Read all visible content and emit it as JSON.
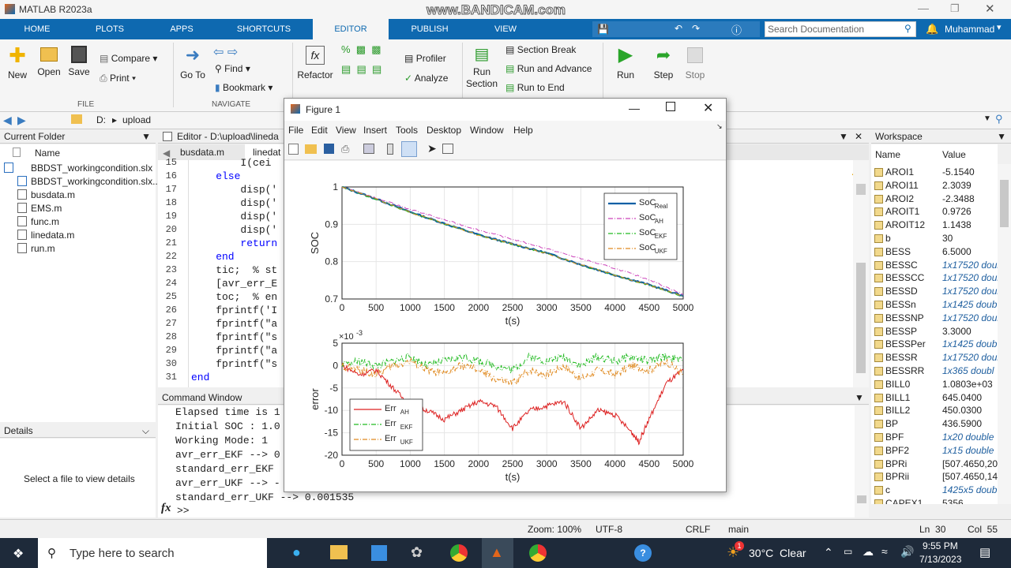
{
  "window": {
    "title": "MATLAB R2023a",
    "watermark": "www.BANDICAM.com"
  },
  "tabs": [
    "HOME",
    "PLOTS",
    "APPS",
    "SHORTCUTS",
    "EDITOR",
    "PUBLISH",
    "VIEW"
  ],
  "active_tab": "EDITOR",
  "search": {
    "placeholder": "Search Documentation"
  },
  "user": "Muhammad",
  "ribbon": {
    "file": {
      "new": "New",
      "open": "Open",
      "save": "Save",
      "compare": "Compare",
      "print": "Print",
      "section": "FILE"
    },
    "navigate": {
      "goto": "Go To",
      "find": "Find",
      "bookmark": "Bookmark",
      "section": "NAVIGATE"
    },
    "code": {
      "refactor": "Refactor",
      "profiler": "Profiler",
      "analyze": "Analyze"
    },
    "section": {
      "run_section": "Run Section",
      "section_break": "Section Break",
      "run_advance": "Run and Advance",
      "run_end": "Run to End"
    },
    "run": {
      "run": "Run",
      "step": "Step",
      "stop": "Stop"
    }
  },
  "address": {
    "drive": "D:",
    "folder": "upload"
  },
  "current_folder": {
    "title": "Current Folder",
    "col_name": "Name",
    "files": [
      "BBDST_workingcondition.slx",
      "BBDST_workingcondition.slx...",
      "busdata.m",
      "EMS.m",
      "func.m",
      "linedata.m",
      "run.m"
    ]
  },
  "details": {
    "title": "Details",
    "message": "Select a file to view details"
  },
  "editor": {
    "title": "Editor - D:\\upload\\lineda",
    "tabs": [
      "busdata.m",
      "linedat"
    ],
    "lines": [
      {
        "n": "15",
        "text": "        I(cei"
      },
      {
        "n": "16",
        "text": "    else"
      },
      {
        "n": "17",
        "text": "        disp('"
      },
      {
        "n": "18",
        "text": "        disp('"
      },
      {
        "n": "19",
        "text": "        disp('"
      },
      {
        "n": "20",
        "text": "        disp('"
      },
      {
        "n": "21",
        "text": "        return"
      },
      {
        "n": "22",
        "text": "    end"
      },
      {
        "n": "23",
        "text": "    tic;  % st"
      },
      {
        "n": "24",
        "text": "    [avr_err_E"
      },
      {
        "n": "25",
        "text": "    toc;  % en"
      },
      {
        "n": "26",
        "text": "    fprintf('I"
      },
      {
        "n": "27",
        "text": "    fprintf(\"a"
      },
      {
        "n": "28",
        "text": "    fprintf(\"s"
      },
      {
        "n": "29",
        "text": "    fprintf(\"a"
      },
      {
        "n": "30",
        "text": "    fprintf(\"s"
      },
      {
        "n": "31",
        "text": "end"
      }
    ]
  },
  "command_window": {
    "title": "Command Window",
    "lines": [
      "Elapsed time is 1",
      "Initial SOC : 1.0",
      "Working Mode: 1",
      "avr_err_EKF --> 0",
      "standard_err_EKF",
      "avr_err_UKF --> -",
      "standard_err_UKF --> 0.001535"
    ],
    "prompt": ">>",
    "fx": "fx"
  },
  "workspace": {
    "title": "Workspace",
    "col_name": "Name",
    "col_value": "Value",
    "vars": [
      {
        "name": "AROI1",
        "value": "-5.1540",
        "italic": false
      },
      {
        "name": "AROI11",
        "value": "2.3039",
        "italic": false
      },
      {
        "name": "AROI2",
        "value": "-2.3488",
        "italic": false
      },
      {
        "name": "AROIT1",
        "value": "0.9726",
        "italic": false
      },
      {
        "name": "AROIT12",
        "value": "1.1438",
        "italic": false
      },
      {
        "name": "b",
        "value": "30",
        "italic": false
      },
      {
        "name": "BESS",
        "value": "6.5000",
        "italic": false
      },
      {
        "name": "BESSC",
        "value": "1x17520 doub",
        "italic": true
      },
      {
        "name": "BESSCC",
        "value": "1x17520 doub",
        "italic": true
      },
      {
        "name": "BESSD",
        "value": "1x17520 doub",
        "italic": true
      },
      {
        "name": "BESSn",
        "value": "1x1425 doub",
        "italic": true
      },
      {
        "name": "BESSNP",
        "value": "1x17520 doub",
        "italic": true
      },
      {
        "name": "BESSP",
        "value": "3.3000",
        "italic": false
      },
      {
        "name": "BESSPer",
        "value": "1x1425 doub",
        "italic": true
      },
      {
        "name": "BESSR",
        "value": "1x17520 doub",
        "italic": true
      },
      {
        "name": "BESSRR",
        "value": "1x365 doubl",
        "italic": true
      },
      {
        "name": "BILL0",
        "value": "1.0803e+03",
        "italic": false
      },
      {
        "name": "BILL1",
        "value": "645.0400",
        "italic": false
      },
      {
        "name": "BILL2",
        "value": "450.0300",
        "italic": false
      },
      {
        "name": "BP",
        "value": "436.5900",
        "italic": false
      },
      {
        "name": "BPF",
        "value": "1x20 double",
        "italic": true
      },
      {
        "name": "BPF2",
        "value": "1x15 double",
        "italic": true
      },
      {
        "name": "BPRi",
        "value": "[507.4650,20",
        "italic": false
      },
      {
        "name": "BPRii",
        "value": "[507.4650,14",
        "italic": false
      },
      {
        "name": "c",
        "value": "1425x5 doub",
        "italic": true
      },
      {
        "name": "CAPEX1",
        "value": "5356",
        "italic": false
      }
    ]
  },
  "status": {
    "zoom": "Zoom: 100%",
    "encoding": "UTF-8",
    "eol": "CRLF",
    "func": "main",
    "ln": "Ln  30",
    "col": "Col  55"
  },
  "taskbar": {
    "search": "Type here to search",
    "weather": "30°C  Clear",
    "time": "9:55 PM",
    "date": "7/13/2023",
    "badge": "1"
  },
  "figure": {
    "title": "Figure 1",
    "menu": [
      "File",
      "Edit",
      "View",
      "Insert",
      "Tools",
      "Desktop",
      "Window",
      "Help"
    ]
  },
  "chart_data": [
    {
      "type": "line",
      "xlabel": "t(s)",
      "ylabel": "SOC",
      "xlim": [
        0,
        5000
      ],
      "ylim": [
        0.7,
        1.0
      ],
      "xticks": [
        "0",
        "500",
        "1000",
        "1500",
        "2000",
        "2500",
        "3000",
        "3500",
        "4000",
        "4500",
        "5000"
      ],
      "yticks": [
        "0.7",
        "0.8",
        "0.9",
        "1"
      ],
      "legend_position": "top-right",
      "series": [
        {
          "name": "SoC",
          "sub": "Real",
          "color": "#0b5fa5",
          "style": "solid",
          "x": [
            0,
            500,
            1000,
            1500,
            2000,
            2500,
            3000,
            3500,
            4000,
            4500,
            5000
          ],
          "values": [
            1.0,
            0.968,
            0.933,
            0.902,
            0.872,
            0.847,
            0.823,
            0.792,
            0.764,
            0.738,
            0.708
          ]
        },
        {
          "name": "SoC",
          "sub": "AH",
          "color": "#cc44bb",
          "style": "dashdot",
          "x": [
            0,
            500,
            1000,
            1500,
            2000,
            2500,
            3000,
            3500,
            4000,
            4500,
            5000
          ],
          "values": [
            1.0,
            0.97,
            0.94,
            0.912,
            0.885,
            0.86,
            0.835,
            0.808,
            0.782,
            0.752,
            0.712
          ]
        },
        {
          "name": "SoC",
          "sub": "EKF",
          "color": "#22bb22",
          "style": "dashdot",
          "x": [
            0,
            500,
            1000,
            1500,
            2000,
            2500,
            3000,
            3500,
            4000,
            4500,
            5000
          ],
          "values": [
            1.0,
            0.967,
            0.932,
            0.901,
            0.871,
            0.846,
            0.822,
            0.791,
            0.763,
            0.737,
            0.707
          ]
        },
        {
          "name": "SoC",
          "sub": "UKF",
          "color": "#e08a20",
          "style": "dashdot",
          "x": [
            0,
            500,
            1000,
            1500,
            2000,
            2500,
            3000,
            3500,
            4000,
            4500,
            5000
          ],
          "values": [
            1.0,
            0.968,
            0.932,
            0.902,
            0.871,
            0.847,
            0.822,
            0.792,
            0.764,
            0.737,
            0.708
          ]
        }
      ]
    },
    {
      "type": "line",
      "xlabel": "t(s)",
      "ylabel": "error",
      "scale_label": "×10",
      "scale_exp": "-3",
      "xlim": [
        0,
        5000
      ],
      "ylim": [
        -20,
        5
      ],
      "xticks": [
        "0",
        "500",
        "1000",
        "1500",
        "2000",
        "2500",
        "3000",
        "3500",
        "4000",
        "4500",
        "5000"
      ],
      "yticks": [
        "-20",
        "-15",
        "-10",
        "-5",
        "0",
        "5"
      ],
      "legend_position": "bottom-left",
      "series": [
        {
          "name": "Err",
          "sub": "AH",
          "color": "#dd2222",
          "style": "solid",
          "x": [
            0,
            250,
            500,
            750,
            1000,
            1250,
            1500,
            1750,
            2000,
            2250,
            2500,
            2750,
            3000,
            3250,
            3500,
            3750,
            4000,
            4250,
            4350,
            4500,
            4750,
            5000
          ],
          "values": [
            0,
            -2,
            -1,
            -5,
            -9,
            -10,
            -12,
            -10,
            -8,
            -9,
            -14,
            -10,
            -9,
            -8,
            -14,
            -10,
            -11,
            -15,
            -17,
            -12,
            -4,
            -1
          ]
        },
        {
          "name": "Err",
          "sub": "EKF",
          "color": "#22bb22",
          "style": "dashdot",
          "x": [
            0,
            250,
            500,
            750,
            1000,
            1250,
            1500,
            1750,
            2000,
            2250,
            2500,
            2750,
            3000,
            3250,
            3500,
            3750,
            4000,
            4250,
            4500,
            4750,
            5000
          ],
          "values": [
            0,
            1,
            0,
            1,
            2,
            0,
            1,
            2,
            1,
            0,
            -1,
            2,
            1,
            2,
            0,
            2,
            1,
            2,
            1,
            2,
            1
          ]
        },
        {
          "name": "Err",
          "sub": "UKF",
          "color": "#e08a20",
          "style": "dashdot",
          "x": [
            0,
            250,
            500,
            750,
            1000,
            1250,
            1500,
            1750,
            2000,
            2250,
            2500,
            2750,
            3000,
            3250,
            3500,
            3750,
            4000,
            4250,
            4500,
            4750,
            5000
          ],
          "values": [
            0,
            -1,
            -2,
            0,
            1,
            -1,
            -2,
            0,
            -1,
            -3,
            -4,
            -1,
            -2,
            0,
            -3,
            -1,
            -2,
            0,
            -1,
            1,
            -2
          ]
        }
      ]
    }
  ]
}
